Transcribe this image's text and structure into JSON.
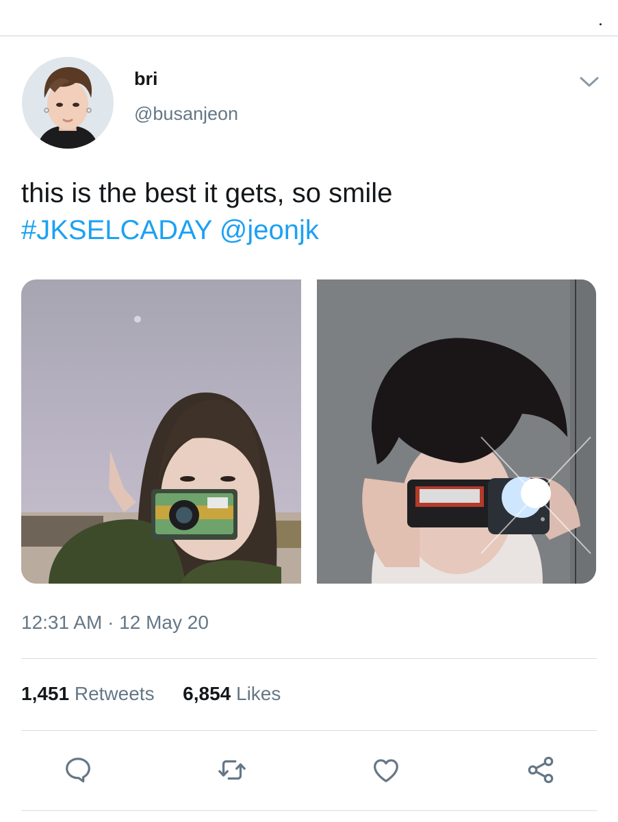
{
  "tweet": {
    "display_name": "bri",
    "handle": "@busanjeon",
    "text_line1": "this is the best it gets, so smile",
    "hashtag": "#JKSELCADAY",
    "mention": "@jeonjk",
    "timestamp": "12:31 AM · 12 May 20"
  },
  "stats": {
    "retweets_count": "1,451",
    "retweets_label": "Retweets",
    "likes_count": "6,854",
    "likes_label": "Likes"
  },
  "icons": {
    "menu": "chevron-down-icon",
    "reply": "reply-icon",
    "retweet": "retweet-icon",
    "like": "heart-icon",
    "share": "share-icon"
  },
  "colors": {
    "link": "#1da1f2",
    "secondary_text": "#657786",
    "action_icon": "#657786"
  }
}
